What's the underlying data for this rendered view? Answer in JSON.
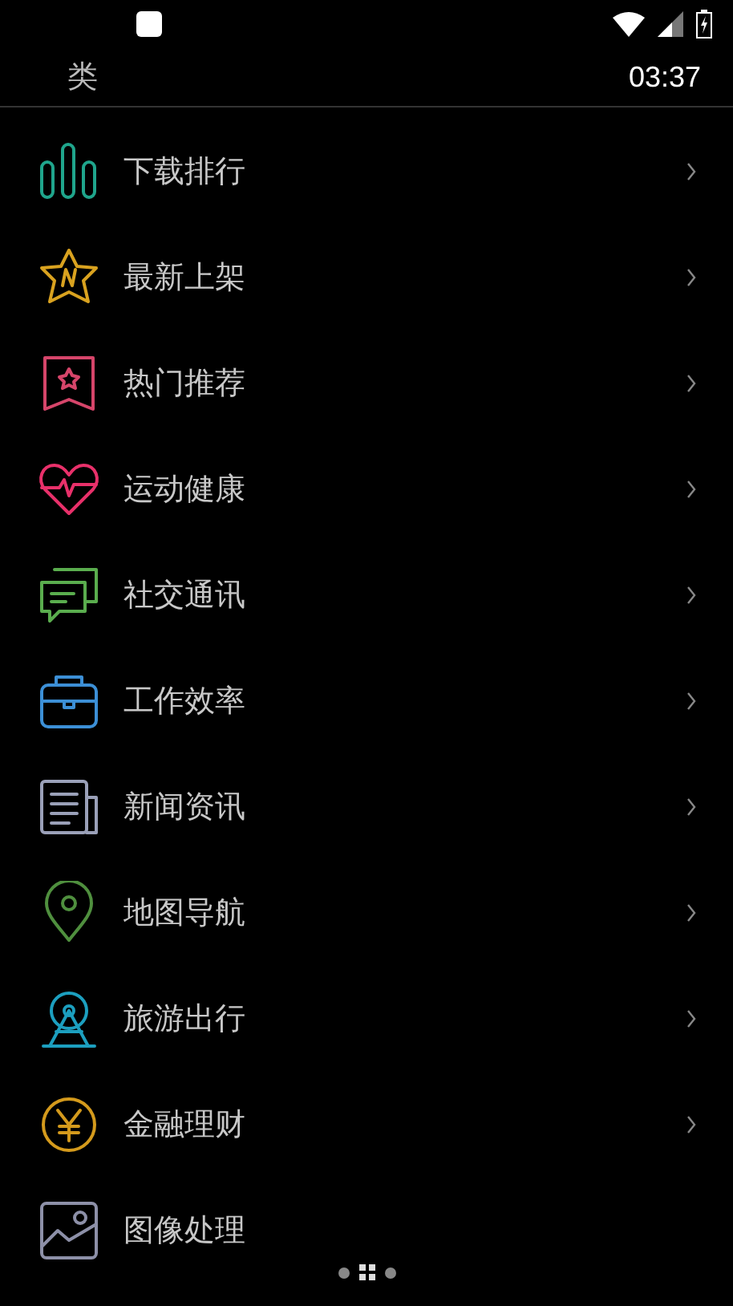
{
  "header": {
    "title": "类",
    "time": "03:37"
  },
  "categories": [
    {
      "label": "下载排行",
      "color": "#1fa58c",
      "arrow": true
    },
    {
      "label": "最新上架",
      "color": "#d9a21f",
      "arrow": true
    },
    {
      "label": "热门推荐",
      "color": "#d6456a",
      "arrow": true
    },
    {
      "label": "运动健康",
      "color": "#e8306a",
      "arrow": true
    },
    {
      "label": "社交通讯",
      "color": "#5aad4e",
      "arrow": true
    },
    {
      "label": "工作效率",
      "color": "#3c8fd6",
      "arrow": true
    },
    {
      "label": "新闻资讯",
      "color": "#9aa0b8",
      "arrow": true
    },
    {
      "label": "地图导航",
      "color": "#4f8f3e",
      "arrow": true
    },
    {
      "label": "旅游出行",
      "color": "#1c9fbf",
      "arrow": true
    },
    {
      "label": "金融理财",
      "color": "#d49a1c",
      "arrow": true
    },
    {
      "label": "图像处理",
      "color": "#8d90a8",
      "arrow": false
    }
  ],
  "pager": [
    {
      "kind": "dot",
      "selected": false
    },
    {
      "kind": "grid",
      "selected": true
    },
    {
      "kind": "dot",
      "selected": false
    }
  ]
}
